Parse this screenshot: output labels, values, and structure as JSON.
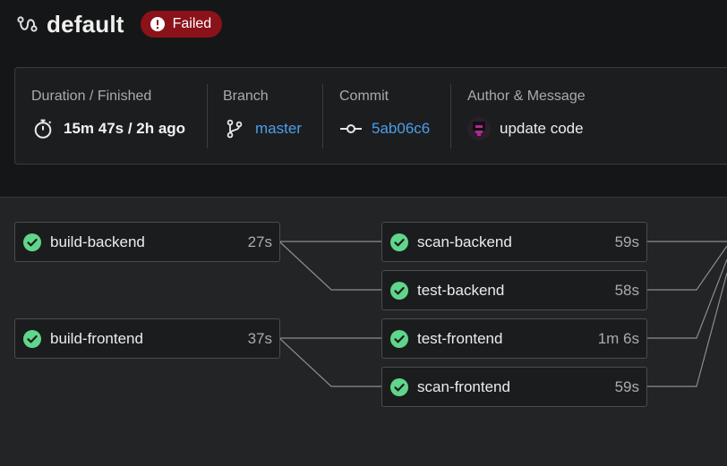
{
  "header": {
    "pipeline_icon": "pipeline-icon",
    "title": "default",
    "status": {
      "label": "Failed",
      "icon": "exclamation-circle-icon",
      "color": "#8b1219"
    }
  },
  "info": {
    "duration": {
      "label": "Duration / Finished",
      "value": "15m 47s / 2h ago",
      "icon": "stopwatch-icon"
    },
    "branch": {
      "label": "Branch",
      "value": "master",
      "icon": "git-branch-icon"
    },
    "commit": {
      "label": "Commit",
      "value": "5ab06c6",
      "icon": "git-commit-icon"
    },
    "author": {
      "label": "Author & Message",
      "message": "update code",
      "icon": "avatar"
    }
  },
  "jobs": [
    {
      "name": "build-backend",
      "duration": "27s",
      "status": "success"
    },
    {
      "name": "build-frontend",
      "duration": "37s",
      "status": "success"
    },
    {
      "name": "scan-backend",
      "duration": "59s",
      "status": "success"
    },
    {
      "name": "test-backend",
      "duration": "58s",
      "status": "success"
    },
    {
      "name": "test-frontend",
      "duration": "1m 6s",
      "status": "success"
    },
    {
      "name": "scan-frontend",
      "duration": "59s",
      "status": "success"
    }
  ],
  "colors": {
    "success": "#5fd68a",
    "link": "#4c9eea",
    "failed": "#8b1219"
  }
}
